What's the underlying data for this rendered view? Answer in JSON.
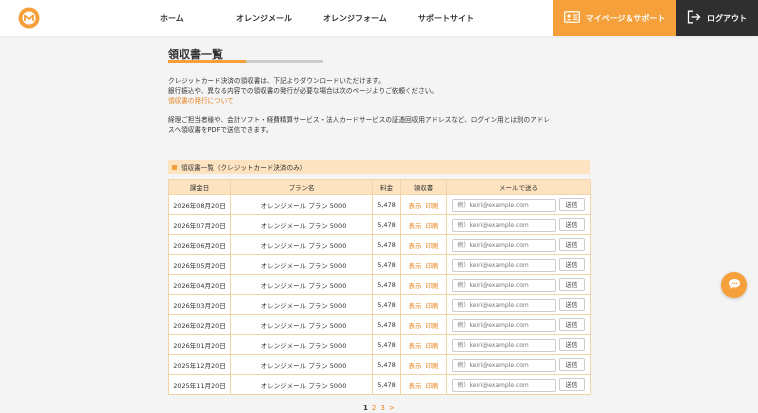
{
  "colors": {
    "accent": "#f5a03a",
    "link": "#e8821e",
    "dark": "#2f2f2f",
    "table_header": "#fde3bf"
  },
  "header": {
    "logo_icon": "orange-m-logo",
    "nav": [
      "ホーム",
      "オレンジメール",
      "オレンジフォーム",
      "サポートサイト"
    ],
    "mypage_label": "マイページ＆サポート",
    "logout_label": "ログアウト"
  },
  "main": {
    "title": "領収書一覧",
    "intro_line1": "クレジットカード決済の領収書は、下記よりダウンロードいただけます。",
    "intro_line2": "銀行振込や、異なる内容での領収書の発行が必要な場合は次のページよりご依頼ください。",
    "intro_link": "領収書の発行について",
    "info_line1": "経理ご担当者様や、会計ソフト・経費精算サービス・法人カードサービスの証憑回収用アドレスなど、ログイン用とは別のアドレ",
    "info_line2": "スへ領収書をPDFで送信できます。",
    "section_title": "領収書一覧（クレジットカード決済のみ）"
  },
  "table": {
    "headers": [
      "課金日",
      "プラン名",
      "料金",
      "領収書",
      "メールで送る"
    ],
    "view_label": "表示",
    "print_label": "印刷",
    "email_placeholder": "例）keiri@example.com",
    "send_label": "送信",
    "rows": [
      {
        "date": "2026年08月20日",
        "plan": "オレンジメール プラン 5000",
        "price": "5,478"
      },
      {
        "date": "2026年07月20日",
        "plan": "オレンジメール プラン 5000",
        "price": "5,478"
      },
      {
        "date": "2026年06月20日",
        "plan": "オレンジメール プラン 5000",
        "price": "5,478"
      },
      {
        "date": "2026年05月20日",
        "plan": "オレンジメール プラン 5000",
        "price": "5,478"
      },
      {
        "date": "2026年04月20日",
        "plan": "オレンジメール プラン 5000",
        "price": "5,478"
      },
      {
        "date": "2026年03月20日",
        "plan": "オレンジメール プラン 5000",
        "price": "5,478"
      },
      {
        "date": "2026年02月20日",
        "plan": "オレンジメール プラン 5000",
        "price": "5,478"
      },
      {
        "date": "2026年01月20日",
        "plan": "オレンジメール プラン 5000",
        "price": "5,478"
      },
      {
        "date": "2025年12月20日",
        "plan": "オレンジメール プラン 5000",
        "price": "5,478"
      },
      {
        "date": "2025年11月20日",
        "plan": "オレンジメール プラン 5000",
        "price": "5,478"
      }
    ]
  },
  "pager": {
    "current": "1",
    "pages": [
      "2",
      "3"
    ],
    "next": ">"
  },
  "chat": {
    "icon": "chat-bubble-icon"
  }
}
